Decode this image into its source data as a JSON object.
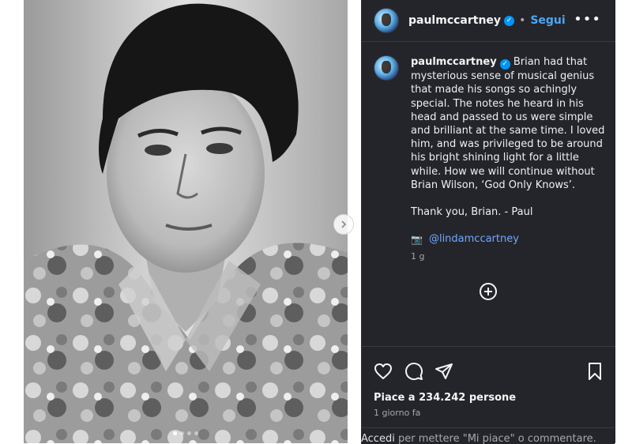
{
  "post": {
    "username": "paulmccartney",
    "follow_label": "Segui",
    "separator": "•",
    "more_label": "•••",
    "caption": "Brian had that mysterious sense of musical genius that made his songs so achingly special. The notes he heard in his head and passed to us were simple and brilliant at the same time. I loved him, and was privileged to be around his bright shining light for a little while. How we will continue without Brian Wilson, ‘God Only Knows’.",
    "caption_sign": "Thank you, Brian. - Paul",
    "camera_icon": "📷",
    "mention": "@lindamccartney",
    "caption_age": "1 g",
    "likes": "Piace a 234.242 persone",
    "posted": "1 giorno fa",
    "login_link": "Accedi",
    "login_rest": " per mettere \"Mi piace\" o commentare."
  },
  "carousel": {
    "slides": 4,
    "active": 0
  },
  "icons": [
    "verified-badge-icon",
    "more-options-icon",
    "chevron-right-icon",
    "plus-circle-icon",
    "heart-icon",
    "comment-icon",
    "share-icon",
    "bookmark-icon",
    "camera-icon"
  ],
  "colors": {
    "panel_bg": "#24252b",
    "link_blue": "#4ca7f2",
    "verified_blue": "#0095f6"
  }
}
